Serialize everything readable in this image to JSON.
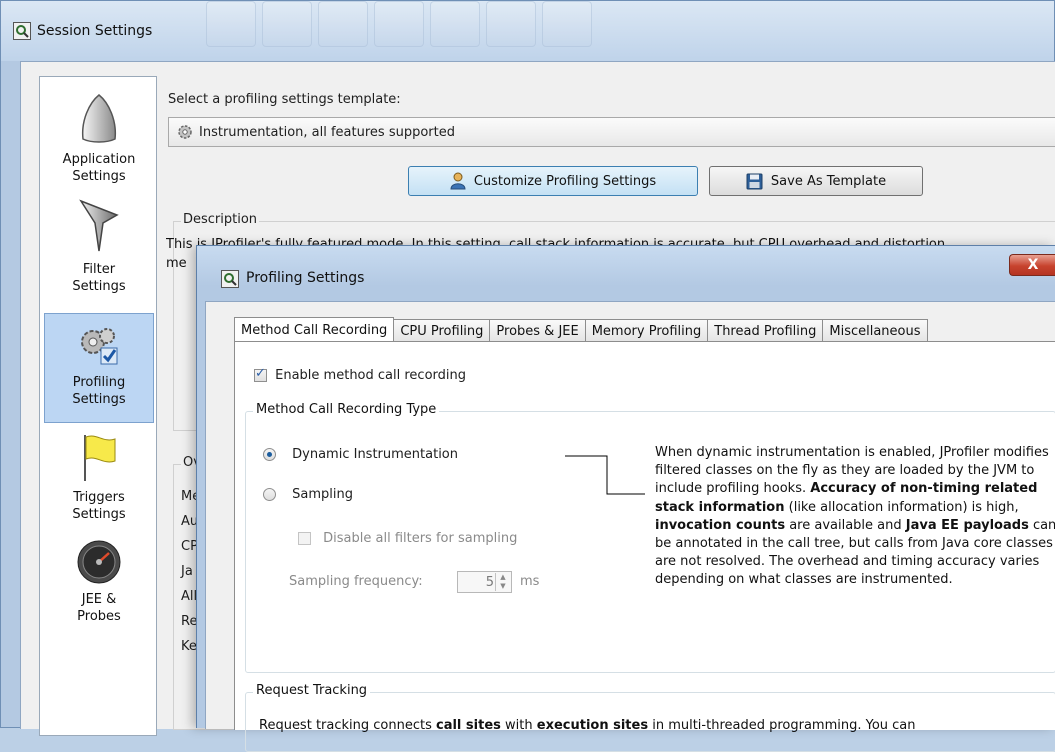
{
  "window": {
    "title": "Session Settings"
  },
  "sidebar": {
    "items": [
      {
        "label_line1": "Application",
        "label_line2": "Settings",
        "icon": "application-settings-icon"
      },
      {
        "label_line1": "Filter",
        "label_line2": "Settings",
        "icon": "filter-funnel-icon"
      },
      {
        "label_line1": "Profiling",
        "label_line2": "Settings",
        "icon": "profiling-gears-icon",
        "selected": true
      },
      {
        "label_line1": "Triggers",
        "label_line2": "Settings",
        "icon": "triggers-flag-icon"
      },
      {
        "label_line1": "JEE &",
        "label_line2": "Probes",
        "icon": "jee-probes-gauge-icon"
      }
    ]
  },
  "main": {
    "template_label": "Select a profiling settings template:",
    "template_value": "Instrumentation, all features supported",
    "customize_button": "Customize Profiling Settings",
    "save_template_button": "Save As Template",
    "description_label": "Description",
    "description_line1": "This is JProfiler's fully featured mode. In this setting, call stack information is accurate, but CPU overhead and distortion",
    "description_line2": "me",
    "overview_label": "Ov",
    "overview_rows": [
      "Me",
      "Au",
      "CP",
      "Ja",
      "All",
      "Re",
      "Ke"
    ]
  },
  "dialog": {
    "title": "Profiling Settings",
    "close_label": "X",
    "tabs": [
      "Method Call Recording",
      "CPU Profiling",
      "Probes & JEE",
      "Memory Profiling",
      "Thread Profiling",
      "Miscellaneous"
    ],
    "active_tab_index": 0,
    "enable_checkbox": {
      "label": "Enable method call recording",
      "checked": true
    },
    "recording_type_group": "Method Call Recording Type",
    "dynamic_radio": {
      "label": "Dynamic Instrumentation",
      "selected": true
    },
    "sampling_radio": {
      "label": "Sampling",
      "selected": false
    },
    "disable_filters_checkbox": {
      "label": "Disable all filters for sampling",
      "checked": false,
      "enabled": false
    },
    "sampling_frequency_label": "Sampling frequency:",
    "sampling_frequency_value": "5",
    "sampling_frequency_unit": "ms",
    "explanation": {
      "p1": "When dynamic instrumentation is enabled, JProfiler modifies filtered classes on the fly as they are loaded by the JVM to include profiling hooks.",
      "b1": "Accuracy of non-timing related stack information",
      "p2": " (like allocation information) is high, ",
      "b2": "invocation counts",
      "p3": " are available and ",
      "b3": "Java EE payloads",
      "p4": " can be annotated in the call tree, but calls from Java core classes are not resolved. The overhead and timing accuracy varies depending on what classes are instrumented."
    },
    "request_tracking_group": "Request Tracking",
    "request_tracking_text_a": "Request tracking connects ",
    "request_tracking_bold_a": "call sites",
    "request_tracking_text_b": " with ",
    "request_tracking_bold_b": "execution sites",
    "request_tracking_text_c": " in multi-threaded programming. You can"
  },
  "colors": {
    "selection": "#bcd6f3",
    "close_button": "#c7432e",
    "window_frame": "#b4c9e2"
  }
}
